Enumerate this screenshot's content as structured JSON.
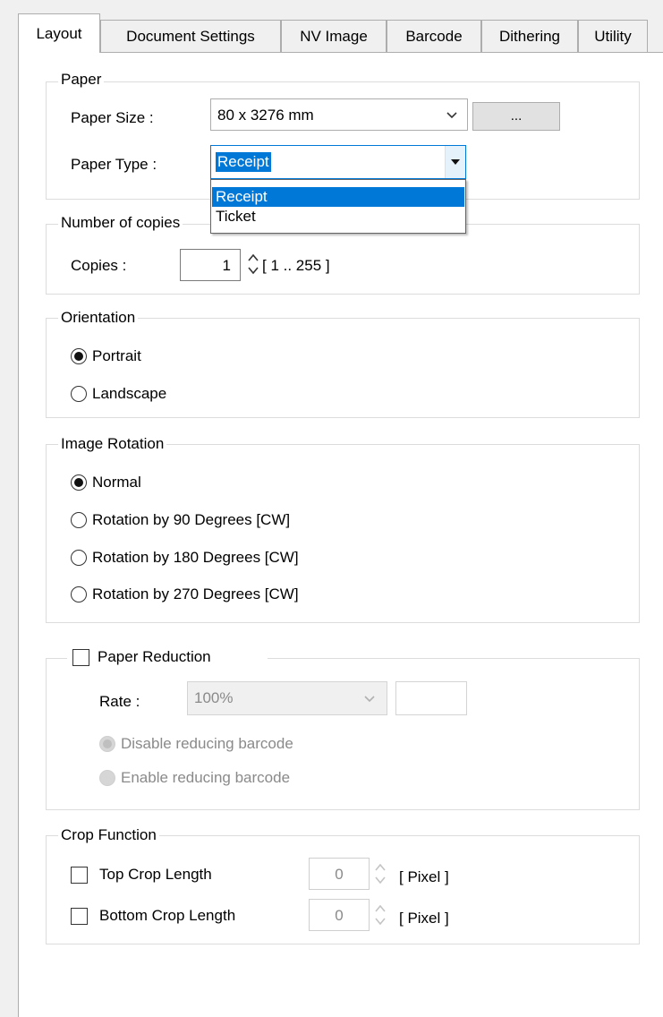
{
  "tabs": [
    {
      "label": "Layout"
    },
    {
      "label": "Document Settings"
    },
    {
      "label": "NV Image"
    },
    {
      "label": "Barcode"
    },
    {
      "label": "Dithering"
    },
    {
      "label": "Utility"
    }
  ],
  "paper": {
    "legend": "Paper",
    "size_label": "Paper Size :",
    "size_value": "80 x 3276 mm",
    "browse_label": "...",
    "type_label": "Paper Type :",
    "type_value": "Receipt",
    "type_options": [
      "Receipt",
      "Ticket"
    ]
  },
  "copies": {
    "legend": "Number of copies",
    "label": "Copies :",
    "value": "1",
    "range": "[ 1 .. 255 ]"
  },
  "orientation": {
    "legend": "Orientation",
    "options": [
      "Portrait",
      "Landscape"
    ],
    "selected": "Portrait"
  },
  "rotation": {
    "legend": "Image Rotation",
    "options": [
      "Normal",
      "Rotation by 90 Degrees [CW]",
      "Rotation by 180 Degrees [CW]",
      "Rotation by 270 Degrees [CW]"
    ],
    "selected": "Normal"
  },
  "reduction": {
    "legend": "Paper Reduction",
    "rate_label": "Rate :",
    "rate_value": "100%",
    "options": [
      "Disable reducing barcode",
      "Enable reducing barcode"
    ]
  },
  "crop": {
    "legend": "Crop Function",
    "top_label": "Top Crop Length",
    "top_value": "0",
    "bottom_label": "Bottom Crop Length",
    "bottom_value": "0",
    "unit": "[ Pixel ]"
  },
  "colors": {
    "selection": "#0078d7",
    "border": "#adadad"
  }
}
